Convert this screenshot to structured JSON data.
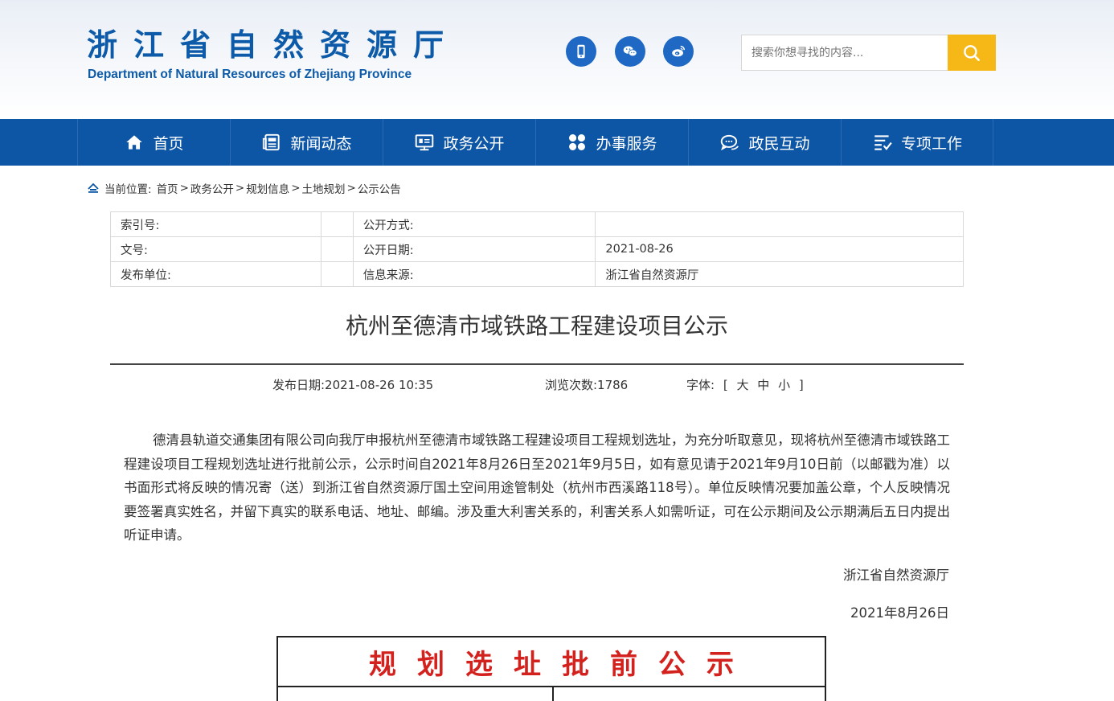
{
  "header": {
    "logo_cn": "浙江省自然资源厅",
    "logo_en": "Department of Natural Resources of Zhejiang Province",
    "social_icons": [
      "mobile-icon",
      "wechat-icon",
      "weibo-icon"
    ],
    "search_placeholder": "搜索你想寻找的内容...",
    "brand_color": "#0d5ba8",
    "search_button_color": "#f5b817"
  },
  "nav": {
    "color": "#0d56a6",
    "items": [
      {
        "label": "首页",
        "icon": "home-icon"
      },
      {
        "label": "新闻动态",
        "icon": "news-icon"
      },
      {
        "label": "政务公开",
        "icon": "monitor-icon"
      },
      {
        "label": "办事服务",
        "icon": "grid-icon"
      },
      {
        "label": "政民互动",
        "icon": "chat-icon"
      },
      {
        "label": "专项工作",
        "icon": "list-check-icon"
      }
    ]
  },
  "breadcrumb": {
    "prefix": "当前位置:",
    "items": [
      "首页",
      "政务公开",
      "规划信息",
      "土地规划",
      "公示公告"
    ],
    "separator": ">"
  },
  "meta": {
    "rows": [
      {
        "label1": "索引号:",
        "value1": "",
        "label2": "公开方式:",
        "value2": ""
      },
      {
        "label1": "文号:",
        "value1": "",
        "label2": "公开日期:",
        "value2": "2021-08-26"
      },
      {
        "label1": "发布单位:",
        "value1": "",
        "label2": "信息来源:",
        "value2": "浙江省自然资源厅"
      }
    ]
  },
  "article": {
    "title": "杭州至德清市域铁路工程建设项目公示",
    "publish_date": "发布日期:2021-08-26 10:35",
    "views": "浏览次数:1786",
    "font_label": "字体:",
    "font_bracket_open": "[",
    "font_large": "大",
    "font_medium": "中",
    "font_small": "小",
    "font_bracket_close": "]",
    "body": "德清县轨道交通集团有限公司向我厅申报杭州至德清市域铁路工程建设项目工程规划选址，为充分听取意见，现将杭州至德清市域铁路工程建设项目工程规划选址进行批前公示，公示时间自2021年8月26日至2021年9月5日，如有意见请于2021年9月10日前（以邮戳为准）以书面形式将反映的情况寄（送）到浙江省自然资源厅国土空间用途管制处（杭州市西溪路118号）。单位反映情况要加盖公章，个人反映情况要签署真实姓名，并留下真实的联系电话、地址、邮编。涉及重大利害关系的，利害关系人如需听证，可在公示期间及公示期满后五日内提出听证申请。",
    "signature": "浙江省自然资源厅",
    "sign_date": "2021年8月26日"
  },
  "notice": {
    "title": "规划选址批前公示",
    "title_color": "#d3221e"
  }
}
